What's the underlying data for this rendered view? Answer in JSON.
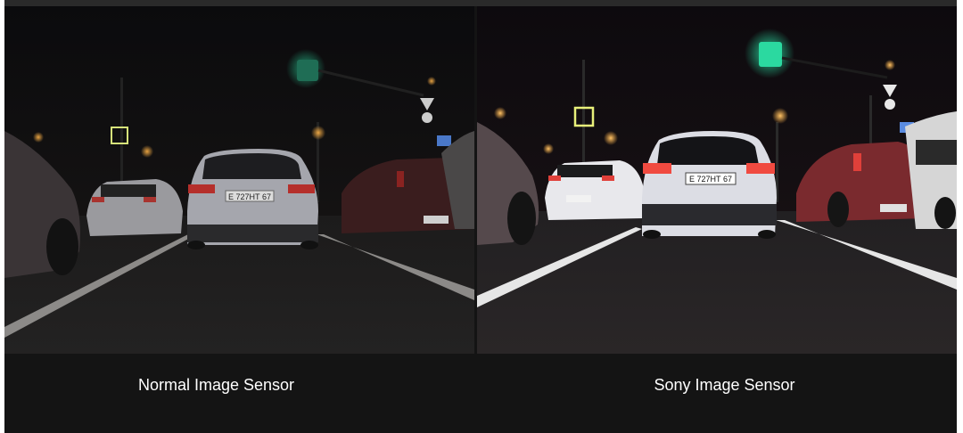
{
  "captions": {
    "left": "Normal Image Sensor",
    "right": "Sony Image Sensor"
  },
  "plates": {
    "left_center": "E 727НТ 67",
    "right_center": "E 727НТ 67"
  },
  "colors": {
    "background": "#141414",
    "caption_text": "#ffffff",
    "traffic_light": "#2bd9a0",
    "street_light": "#ffb347"
  }
}
